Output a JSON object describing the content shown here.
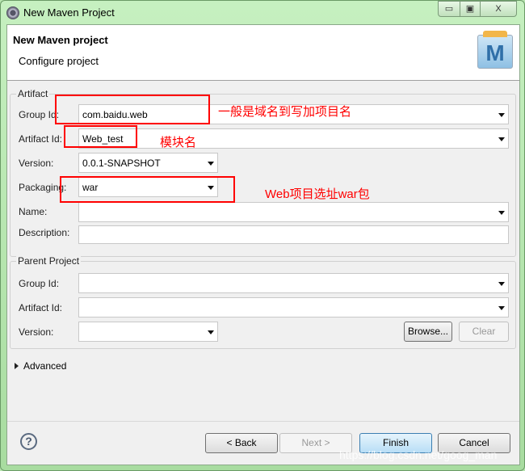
{
  "window": {
    "title": "New Maven Project",
    "controls": {
      "minimize": "▭",
      "maximize": "▣",
      "close": "X"
    }
  },
  "header": {
    "title": "New Maven project",
    "subtitle": "Configure project",
    "logo_letter": "M"
  },
  "artifact": {
    "legend": "Artifact",
    "group_id": {
      "label": "Group Id:",
      "value": "com.baidu.web"
    },
    "artifact_id": {
      "label": "Artifact Id:",
      "value": "Web_test"
    },
    "version": {
      "label": "Version:",
      "value": "0.0.1-SNAPSHOT"
    },
    "packaging": {
      "label": "Packaging:",
      "value": "war"
    },
    "name": {
      "label": "Name:",
      "value": ""
    },
    "description": {
      "label": "Description:",
      "value": ""
    }
  },
  "parent": {
    "legend": "Parent Project",
    "group_id": {
      "label": "Group Id:",
      "value": ""
    },
    "artifact_id": {
      "label": "Artifact Id:",
      "value": ""
    },
    "version": {
      "label": "Version:",
      "value": ""
    },
    "browse": "Browse...",
    "clear": "Clear"
  },
  "advanced": "Advanced",
  "buttons": {
    "back": "< Back",
    "next": "Next >",
    "finish": "Finish",
    "cancel": "Cancel",
    "help": "?"
  },
  "annotations": {
    "group": "一般是域名到写加项目名",
    "artifact": "模块名",
    "packaging": "Web项目选址war包",
    "color": "#ff0000"
  },
  "watermark": "https://blog.csdn.net/goog_man"
}
